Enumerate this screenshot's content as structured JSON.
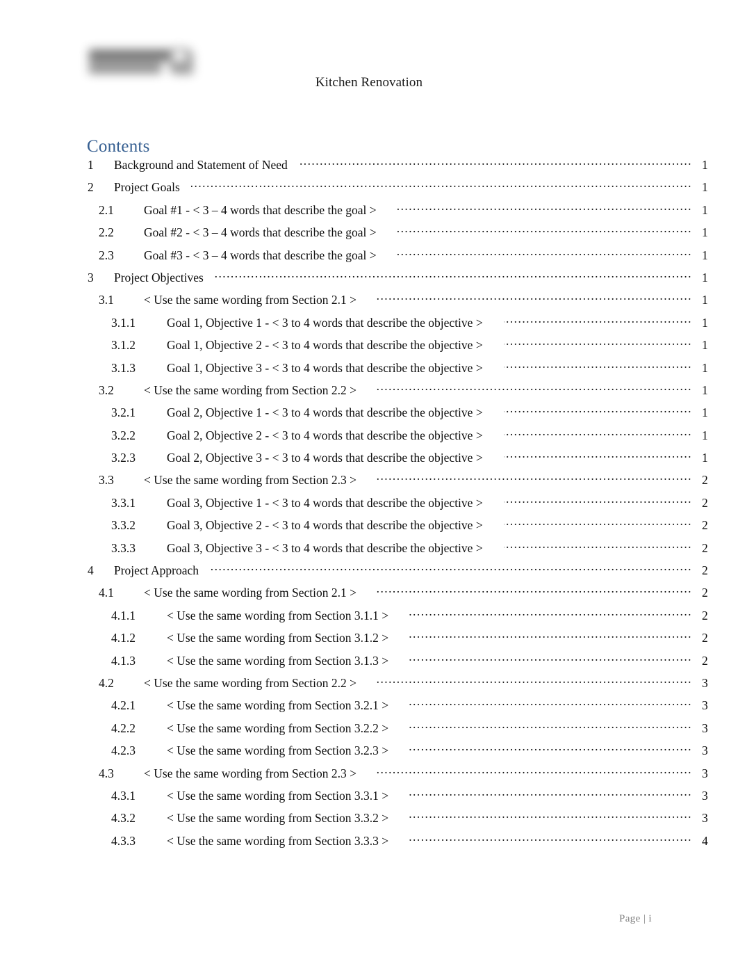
{
  "header": {
    "logo": "company-logo-redacted",
    "title": "Kitchen Renovation"
  },
  "contents": {
    "heading": "Contents"
  },
  "toc": {
    "entries": [
      {
        "level": 1,
        "number": "1",
        "title": "Background and Statement of Need",
        "page": "1"
      },
      {
        "level": 1,
        "number": "2",
        "title": "Project Goals",
        "page": "1"
      },
      {
        "level": 2,
        "number": "2.1",
        "title": "Goal #1 - < 3 – 4 words that describe the goal >",
        "page": "1"
      },
      {
        "level": 2,
        "number": "2.2",
        "title": "Goal #2 - < 3 – 4 words that describe the goal >",
        "page": "1"
      },
      {
        "level": 2,
        "number": "2.3",
        "title": "Goal #3 - < 3 – 4 words that describe the goal >",
        "page": "1"
      },
      {
        "level": 1,
        "number": "3",
        "title": "Project Objectives",
        "page": "1"
      },
      {
        "level": 2,
        "number": "3.1",
        "title": "< Use the same wording from Section 2.1 >",
        "page": "1"
      },
      {
        "level": 3,
        "number": "3.1.1",
        "title": "Goal 1, Objective 1 - < 3 to 4 words that describe the objective >",
        "page": "1"
      },
      {
        "level": 3,
        "number": "3.1.2",
        "title": "Goal 1, Objective 2 - < 3 to 4 words that describe the objective >",
        "page": "1"
      },
      {
        "level": 3,
        "number": "3.1.3",
        "title": "Goal 1, Objective 3 - < 3 to 4 words that describe the objective >",
        "page": "1"
      },
      {
        "level": 2,
        "number": "3.2",
        "title": "< Use the same wording from Section 2.2 >",
        "page": "1"
      },
      {
        "level": 3,
        "number": "3.2.1",
        "title": "Goal 2, Objective 1 - < 3 to 4 words that describe the objective >",
        "page": "1"
      },
      {
        "level": 3,
        "number": "3.2.2",
        "title": "Goal 2, Objective 2 - < 3 to 4 words that describe the objective >",
        "page": "1"
      },
      {
        "level": 3,
        "number": "3.2.3",
        "title": "Goal 2, Objective 3 - < 3 to 4 words that describe the objective >",
        "page": "1"
      },
      {
        "level": 2,
        "number": "3.3",
        "title": "< Use the same wording from Section 2.3 >",
        "page": "2"
      },
      {
        "level": 3,
        "number": "3.3.1",
        "title": "Goal 3, Objective 1 - < 3 to 4 words that describe the objective >",
        "page": "2"
      },
      {
        "level": 3,
        "number": "3.3.2",
        "title": "Goal 3, Objective 2 - < 3 to 4 words that describe the objective >",
        "page": "2"
      },
      {
        "level": 3,
        "number": "3.3.3",
        "title": "Goal 3, Objective 3 - < 3 to 4 words that describe the objective >",
        "page": "2"
      },
      {
        "level": 1,
        "number": "4",
        "title": "Project Approach",
        "page": "2"
      },
      {
        "level": 2,
        "number": "4.1",
        "title": "< Use the same wording from Section 2.1 >",
        "page": "2"
      },
      {
        "level": 3,
        "number": "4.1.1",
        "title": "< Use the same wording from Section 3.1.1 >",
        "page": "2"
      },
      {
        "level": 3,
        "number": "4.1.2",
        "title": "< Use the same wording from Section 3.1.2 >",
        "page": "2"
      },
      {
        "level": 3,
        "number": "4.1.3",
        "title": "< Use the same wording from Section 3.1.3 >",
        "page": "2"
      },
      {
        "level": 2,
        "number": "4.2",
        "title": "< Use the same wording from Section 2.2 >",
        "page": "3"
      },
      {
        "level": 3,
        "number": "4.2.1",
        "title": "< Use the same wording from Section 3.2.1 >",
        "page": "3"
      },
      {
        "level": 3,
        "number": "4.2.2",
        "title": "< Use the same wording from Section 3.2.2 >",
        "page": "3"
      },
      {
        "level": 3,
        "number": "4.2.3",
        "title": "< Use the same wording from Section 3.2.3 >",
        "page": "3"
      },
      {
        "level": 2,
        "number": "4.3",
        "title": "< Use the same wording from Section 2.3 >",
        "page": "3"
      },
      {
        "level": 3,
        "number": "4.3.1",
        "title": "< Use the same wording from Section 3.3.1 >",
        "page": "3"
      },
      {
        "level": 3,
        "number": "4.3.2",
        "title": "< Use the same wording from Section 3.3.2 >",
        "page": "3"
      },
      {
        "level": 3,
        "number": "4.3.3",
        "title": "< Use the same wording from Section 3.3.3 >",
        "page": "4"
      }
    ]
  },
  "footer": {
    "page_label": "Page | i"
  },
  "colors": {
    "heading_blue": "#365F91",
    "body_text": "#0d0d0d",
    "footer_text": "#7f7f7f"
  }
}
